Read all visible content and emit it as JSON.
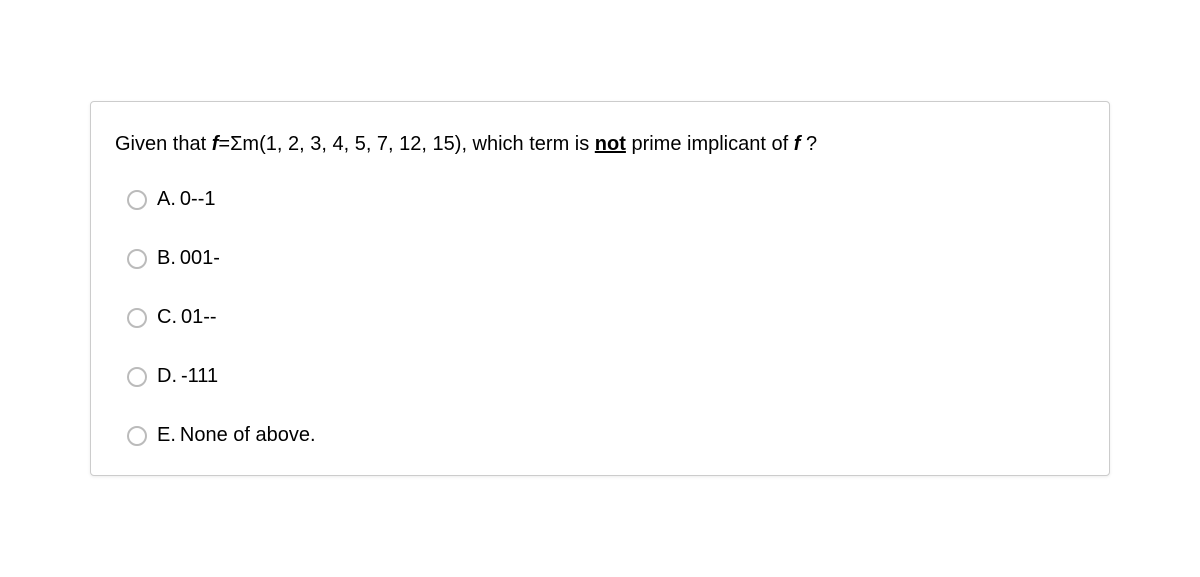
{
  "question": {
    "prefix": "Given that ",
    "func": "f",
    "equals": "=Σm(1, 2, 3, 4, 5, 7, 12, 15), which term is ",
    "not_word": "not",
    "suffix1": " prime implicant of ",
    "func2": "f",
    "qmark": " ?"
  },
  "options": [
    {
      "letter": "A.",
      "text": "0--1"
    },
    {
      "letter": "B.",
      "text": "001-"
    },
    {
      "letter": "C.",
      "text": "01--"
    },
    {
      "letter": "D.",
      "text": "-111"
    },
    {
      "letter": "E.",
      "text": "None of above."
    }
  ]
}
